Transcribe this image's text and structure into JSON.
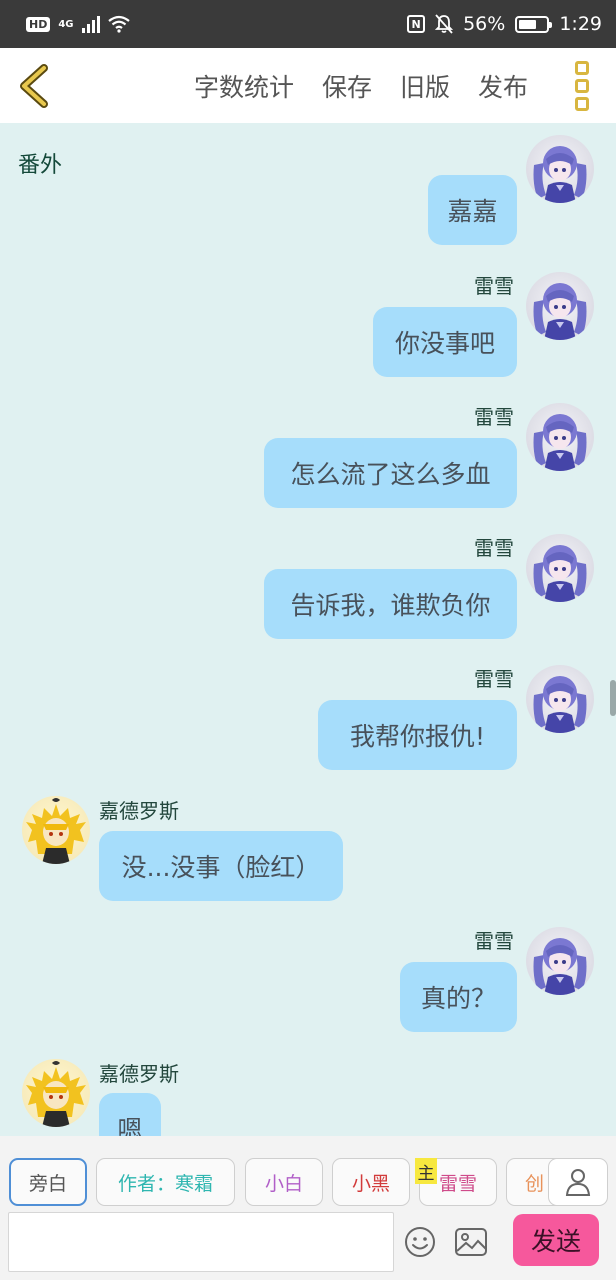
{
  "status_bar": {
    "left_badge": "HD",
    "network": "4G",
    "battery_percent": "56%",
    "time": "1:29",
    "nfc_label": "N",
    "icons": [
      "hd-icon",
      "signal-icon",
      "wifi-icon",
      "nfc-icon",
      "bell-off-icon",
      "battery-icon"
    ]
  },
  "header": {
    "back_icon": "chevron-left-icon",
    "actions": [
      "字数统计",
      "保存",
      "旧版",
      "发布"
    ],
    "more_icon": "more-vertical-icon",
    "accent_color": "#d8b640"
  },
  "chat": {
    "chapter_title": "番外",
    "messages": [
      {
        "sender": "",
        "text": "嘉嘉",
        "side": "right"
      },
      {
        "sender": "雷雪",
        "text": "你没事吧",
        "side": "right"
      },
      {
        "sender": "雷雪",
        "text": "怎么流了这么多血",
        "side": "right"
      },
      {
        "sender": "雷雪",
        "text": "告诉我，谁欺负你",
        "side": "right"
      },
      {
        "sender": "雷雪",
        "text": "我帮你报仇!",
        "side": "right"
      },
      {
        "sender": "嘉德罗斯",
        "text": "没...没事（脸红）",
        "side": "left"
      },
      {
        "sender": "雷雪",
        "text": "真的？",
        "side": "right"
      },
      {
        "sender": "嘉德罗斯",
        "text": "嗯",
        "side": "left"
      }
    ],
    "bubble_color": "#a6ddfb",
    "background_color": "#e0f1f1"
  },
  "roles": {
    "items": [
      {
        "label": "旁白",
        "color": "#555555",
        "selected": true
      },
      {
        "label": "作者：寒霜",
        "color": "#2fb6b0",
        "selected": false
      },
      {
        "label": "小白",
        "color": "#b15fc8",
        "selected": false
      },
      {
        "label": "小黑",
        "color": "#d23b3b",
        "selected": false
      },
      {
        "label": "雷雪",
        "color": "#cf4b8a",
        "selected": false
      },
      {
        "label": "创",
        "color": "#e8925a",
        "selected": false
      }
    ],
    "host_badge": "主",
    "user_icon": "user-icon"
  },
  "composer": {
    "input_value": "",
    "emoji_icon": "emoji-icon",
    "image_icon": "image-icon",
    "send_label": "发送",
    "send_color": "#f6589c"
  }
}
